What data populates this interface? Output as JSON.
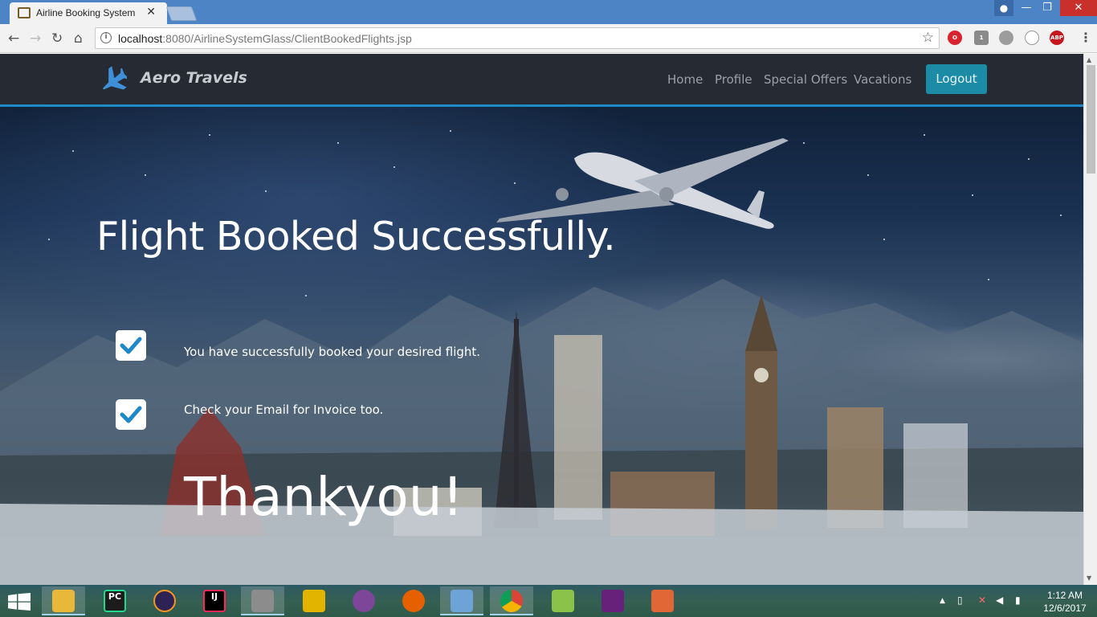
{
  "browser": {
    "tab_title": "Airline Booking System",
    "url_host": "localhost",
    "url_path": ":8080/AirlineSystemGlass/ClientBookedFlights.jsp",
    "ext_abp": "ABP",
    "ext_badge": "1"
  },
  "site": {
    "brand": "Aero Travels",
    "nav": {
      "home": "Home",
      "profile": "Profile",
      "special_offers": "Special Offers",
      "vacations": "Vacations",
      "logout": "Logout"
    }
  },
  "content": {
    "heading": "Flight Booked Successfully.",
    "messages": [
      "You have successfully booked your desired flight.",
      "Check your Email for Invoice too."
    ],
    "thanks": "Thankyou!"
  },
  "taskbar": {
    "apps": [
      "file-explorer",
      "pycharm",
      "eclipse",
      "intellij",
      "tools",
      "vmware",
      "tor",
      "firefox",
      "virtualbox",
      "chrome",
      "notepad-plus",
      "visual-studio",
      "matlab"
    ],
    "time": "1:12 AM",
    "date": "12/6/2017"
  },
  "colors": {
    "navbar": "#252a33",
    "accent": "#1e8ac8",
    "logout_button": "#1b8ba6",
    "check_mark": "#1e88c8"
  }
}
